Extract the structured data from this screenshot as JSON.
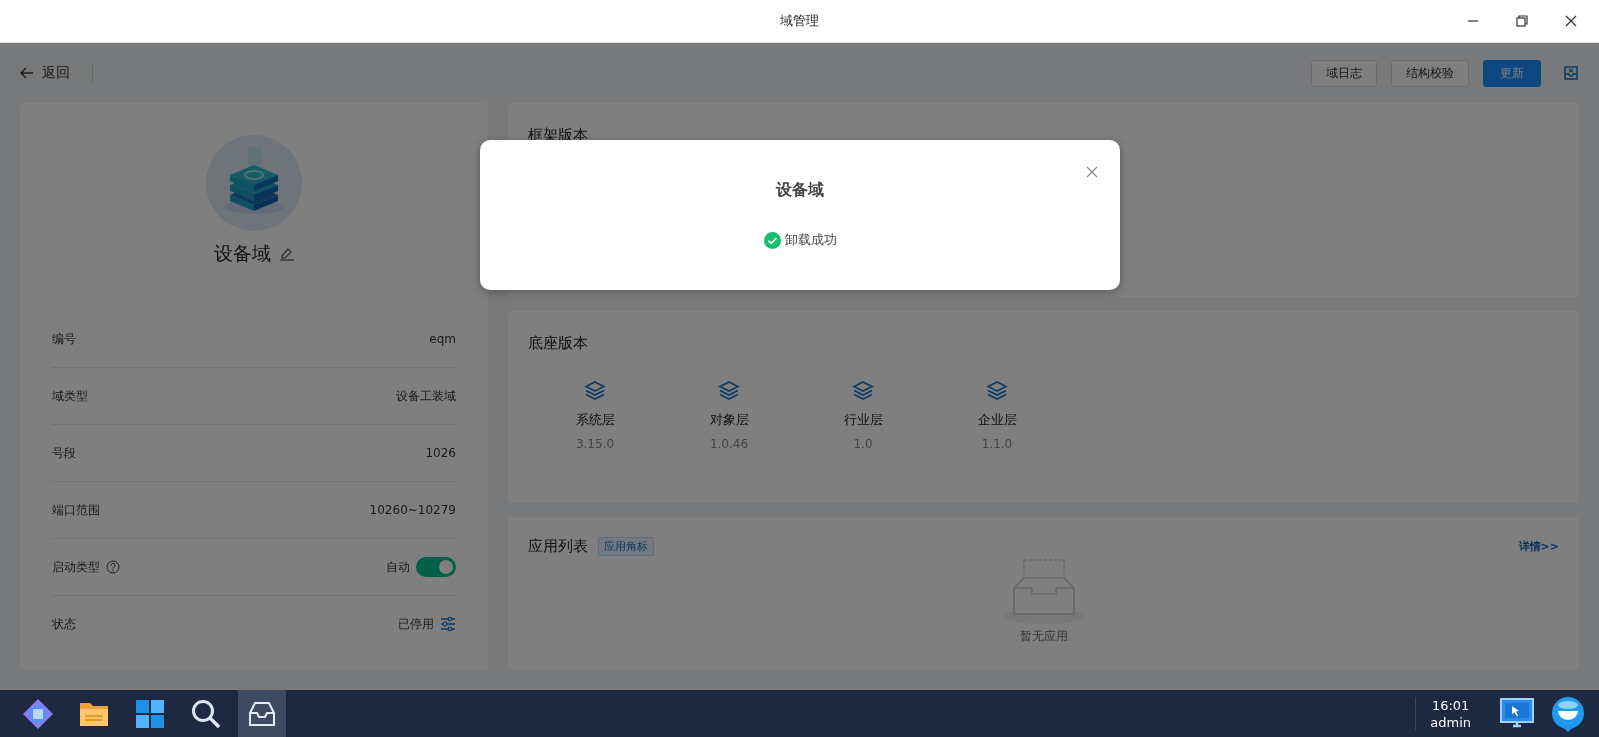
{
  "window": {
    "title": "域管理"
  },
  "toolbar": {
    "back": "返回",
    "buttons": [
      {
        "label": "域日志",
        "kind": "default"
      },
      {
        "label": "结构校验",
        "kind": "default"
      },
      {
        "label": "更新",
        "kind": "primary"
      }
    ]
  },
  "profile": {
    "name": "设备域",
    "fields": [
      {
        "label": "编号",
        "value": "eqm",
        "kind": "text"
      },
      {
        "label": "域类型",
        "value": "设备工装域",
        "kind": "text"
      },
      {
        "label": "号段",
        "value": "1026",
        "kind": "text"
      },
      {
        "label": "端口范围",
        "value": "10260~10279",
        "kind": "text"
      },
      {
        "label": "启动类型",
        "value": "自动",
        "kind": "toggle",
        "on": true
      },
      {
        "label": "状态",
        "value": "已停用",
        "kind": "status"
      }
    ]
  },
  "framework": {
    "title": "框架版本"
  },
  "base": {
    "title": "底座版本",
    "layers": [
      {
        "name": "系统层",
        "version": "3.15.0"
      },
      {
        "name": "对象层",
        "version": "1.0.46"
      },
      {
        "name": "行业层",
        "version": "1.0"
      },
      {
        "name": "企业层",
        "version": "1.1.0"
      }
    ]
  },
  "apps": {
    "title": "应用列表",
    "tag": "应用角标",
    "link": "详情>>",
    "empty": "暂无应用"
  },
  "dialog": {
    "title": "设备域",
    "message": "卸载成功"
  },
  "taskbar": {
    "items": [
      {
        "kind": "launcher",
        "selected": false
      },
      {
        "kind": "folder",
        "selected": false
      },
      {
        "kind": "grid",
        "selected": false
      },
      {
        "kind": "search",
        "selected": false
      },
      {
        "kind": "inbox",
        "selected": true
      }
    ],
    "time": "16:01",
    "user": "admin"
  }
}
